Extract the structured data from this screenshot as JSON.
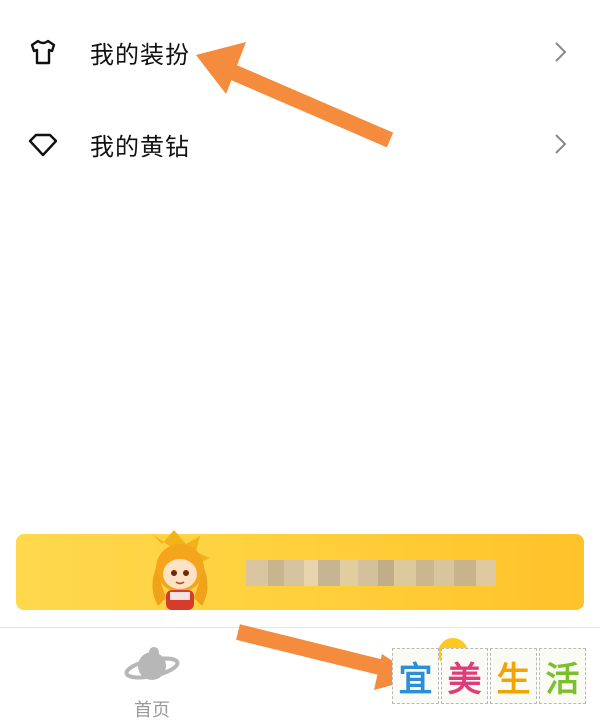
{
  "menu": {
    "items": [
      {
        "label": "我的装扮",
        "icon": "tshirt-icon"
      },
      {
        "label": "我的黄钻",
        "icon": "diamond-icon"
      }
    ]
  },
  "tabbar": {
    "home_label": "首页"
  },
  "watermark": {
    "chars": [
      "宜",
      "美",
      "生",
      "活"
    ],
    "colors": [
      "#2a8fd6",
      "#e13b79",
      "#f2a500",
      "#7bbf2a"
    ]
  },
  "colors": {
    "banner": "#ffcf3a",
    "arrow": "#f58b3c",
    "tab_active": "#ffc81e"
  }
}
